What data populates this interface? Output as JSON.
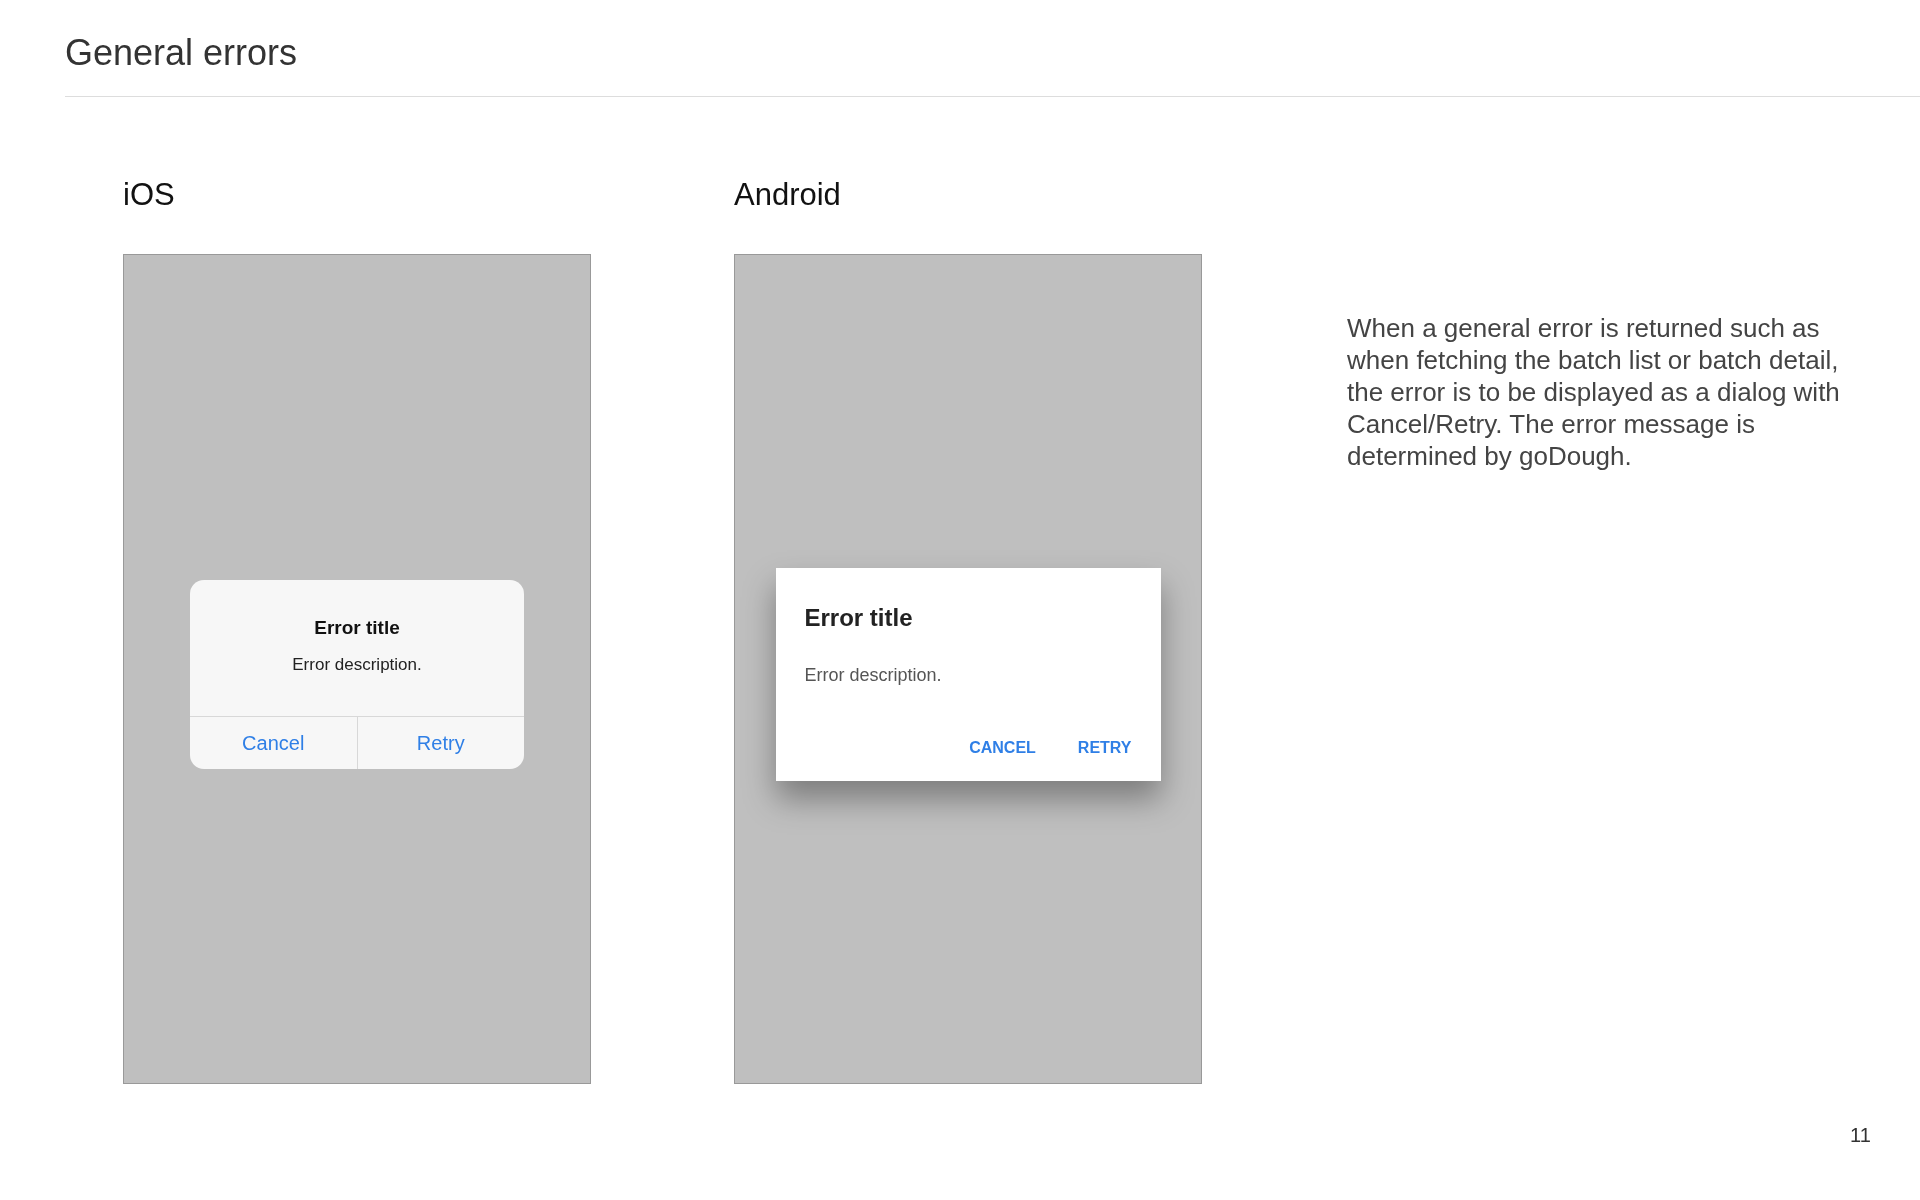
{
  "page_title": "General errors",
  "mockups": [
    {
      "kind": "ios",
      "label": "iOS",
      "dialog": {
        "title": "Error title",
        "description": "Error description.",
        "buttons": [
          "Cancel",
          "Retry"
        ]
      }
    },
    {
      "kind": "android",
      "label": "Android",
      "dialog": {
        "title": "Error title",
        "description": "Error description.",
        "buttons": [
          "CANCEL",
          "RETRY"
        ]
      }
    }
  ],
  "description": "When a general error is returned such as when fetching the batch list or batch detail, the error is to be displayed as a dialog with Cancel/Retry. The error message is determined by goDough.",
  "page_number": "11"
}
